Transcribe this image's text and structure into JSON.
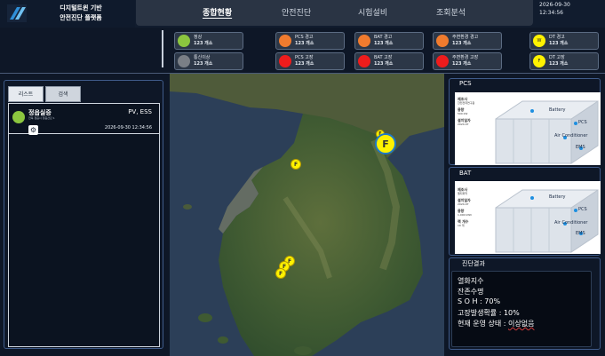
{
  "app": {
    "title_line1": "디지털트윈 기반",
    "title_line2": "안전진단 플랫폼"
  },
  "nav": [
    "종합현황",
    "안전진단",
    "시험설비",
    "조회분석"
  ],
  "datetime": {
    "date": "2026-09-30",
    "time": "12:34:56"
  },
  "status": [
    {
      "label": "정상",
      "count": "123 개소"
    },
    {
      "label": "통신이상",
      "count": "123 개소"
    },
    {
      "label": "PCS 경고",
      "count": "123 개소"
    },
    {
      "label": "PCS 고장",
      "count": "123 개소"
    },
    {
      "label": "BAT 경고",
      "count": "123 개소"
    },
    {
      "label": "BAT 고장",
      "count": "123 개소"
    },
    {
      "label": "주변환경 경고",
      "count": "123 개소"
    },
    {
      "label": "주변환경 고장",
      "count": "123 개소"
    },
    {
      "label": "DT 경고",
      "count": "123 개소",
      "dot": "W"
    },
    {
      "label": "DT 고장",
      "count": "123 개소",
      "dot": "F"
    }
  ],
  "left": {
    "tabs": [
      "리스트",
      "검색"
    ],
    "sites": [
      {
        "name": "정읍실증",
        "address": "전북 정읍시 정읍산단 1",
        "type": "PV, ESS",
        "time": "2026-09-30 12:34:56"
      }
    ]
  },
  "map": {
    "marker_label": "F"
  },
  "right": {
    "pcs": {
      "title": "PCS",
      "meta": [
        {
          "k": "제조사",
          "v": "한전전력연구원"
        },
        {
          "k": "용량",
          "v": "500 kW"
        },
        {
          "k": "설치일자",
          "v": "2024-07"
        }
      ]
    },
    "bat": {
      "title": "BAT",
      "meta": [
        {
          "k": "제조사",
          "v": "엘지화학"
        },
        {
          "k": "설치일자",
          "v": "2024-07"
        },
        {
          "k": "용량",
          "v": "1,000 kWh"
        },
        {
          "k": "랙 개수",
          "v": "10 개"
        }
      ]
    },
    "labels": {
      "battery": "Battery",
      "pcs": "PCS",
      "air_conditioner": "Air Conditioner",
      "ems": "EMS"
    },
    "diagnosis": {
      "title": "진단결과",
      "lines": [
        "열화지수",
        "잔존수명",
        "S O H  : 70%",
        "고장발생확률 : 10%"
      ],
      "status_label": "현재 운영 상태 : ",
      "status_value": "이상없음"
    }
  },
  "colors": {
    "normal": "#8cc63f",
    "comm_error": "#7a7f86",
    "warning": "#f07b2e",
    "fault": "#ee1c1c",
    "dt": "#fff200",
    "accent_border": "#3f5b8a"
  }
}
